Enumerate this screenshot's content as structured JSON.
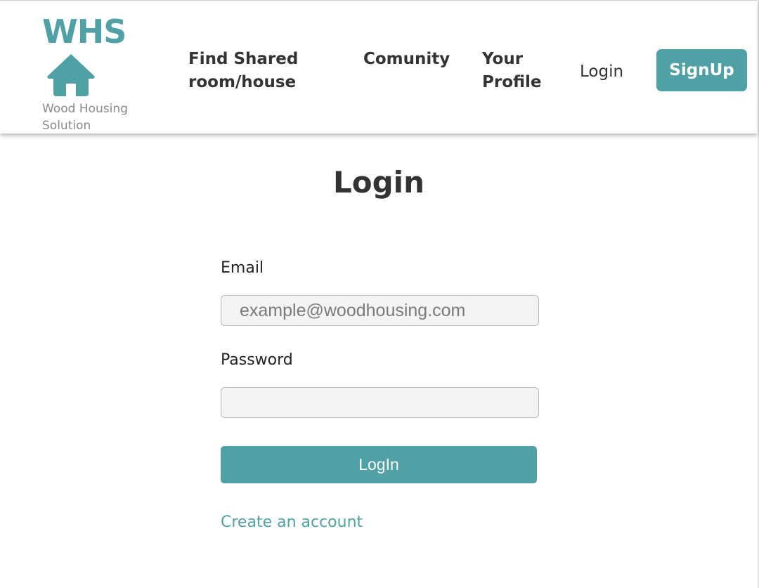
{
  "colors": {
    "accent": "#4fa1a5",
    "text_dark": "#333333",
    "muted": "#8a8a8a",
    "input_bg": "#f3f3f3"
  },
  "header": {
    "brand": {
      "title": "WHS",
      "icon": "house-icon",
      "subtitle": "Wood Housing Solution"
    },
    "nav": {
      "find_shared": "Find Shared room/house",
      "community": "Comunity",
      "profile": "Your Profile",
      "login": "Login",
      "signup": "SignUp"
    }
  },
  "form": {
    "title": "Login",
    "email_label": "Email",
    "email_placeholder": "example@woodhousing.com",
    "email_value": "",
    "password_label": "Password",
    "password_placeholder": "",
    "password_value": "",
    "submit_label": "LogIn",
    "create_account_link": "Create an account"
  }
}
